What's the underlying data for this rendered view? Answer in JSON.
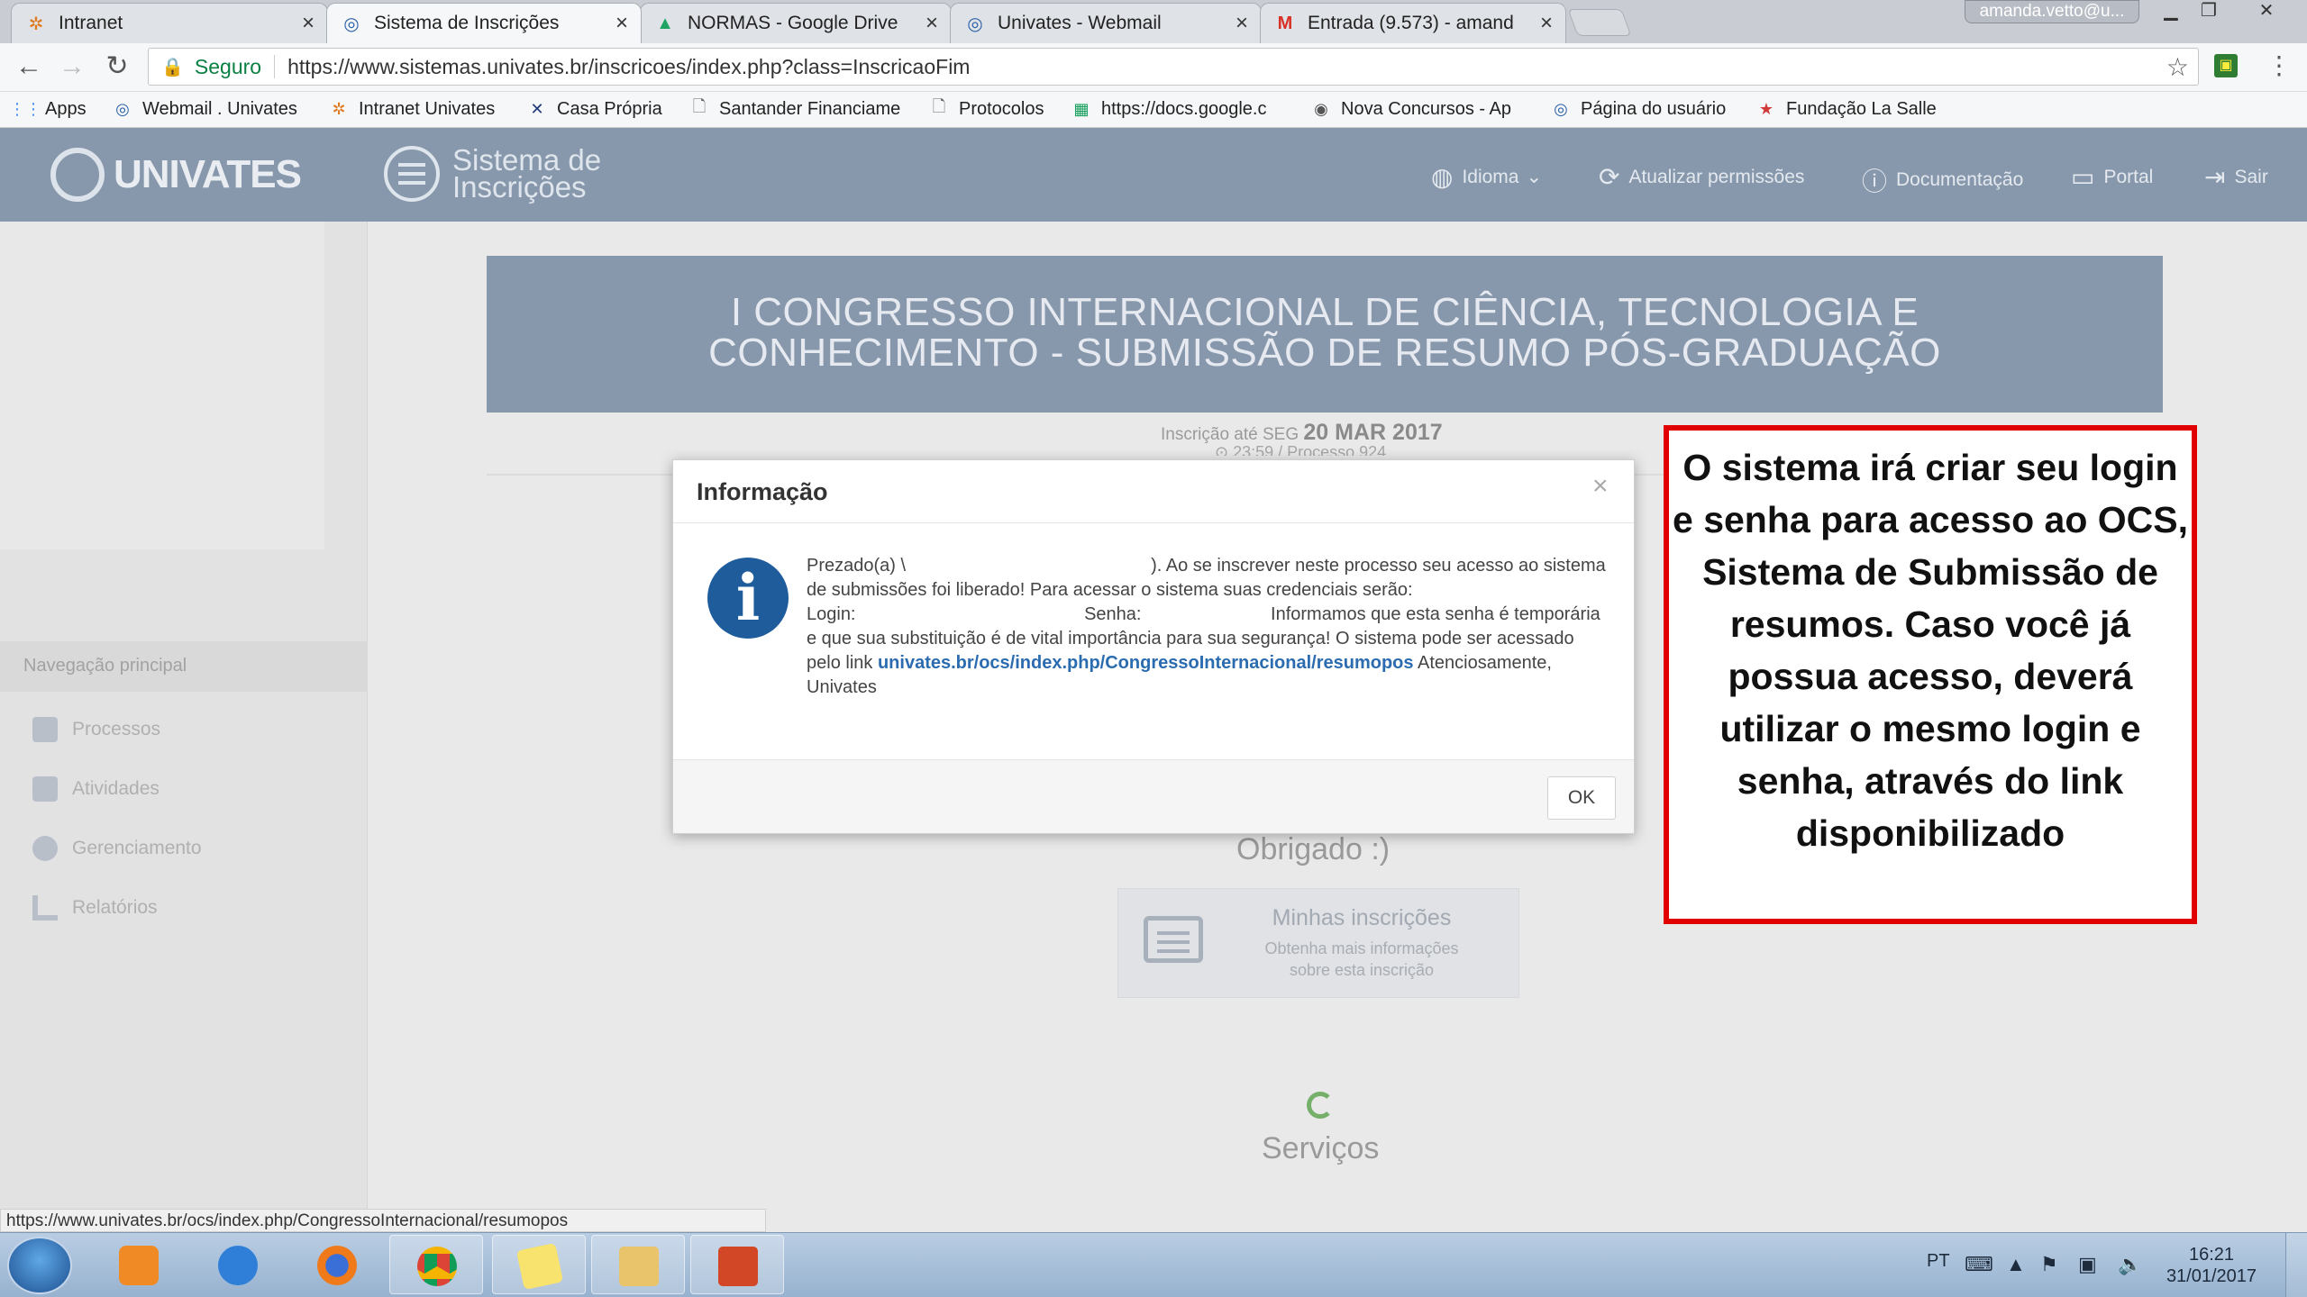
{
  "browser": {
    "tabs": [
      {
        "title": "Intranet",
        "icon": "intranet-icon",
        "active": false
      },
      {
        "title": "Sistema de Inscrições",
        "icon": "univates-icon",
        "active": true
      },
      {
        "title": "NORMAS - Google Drive",
        "icon": "google-drive-icon",
        "active": false
      },
      {
        "title": "Univates - Webmail",
        "icon": "univates-icon",
        "active": false
      },
      {
        "title": "Entrada (9.573) - amand",
        "icon": "gmail-icon",
        "active": false
      }
    ],
    "tab_close_glyph": "×",
    "user_chip": "amanda.vetto@u...",
    "address": {
      "secure_label": "Seguro",
      "url": "https://www.sistemas.univates.br/inscricoes/index.php?class=InscricaoFim"
    },
    "bookmarks": [
      {
        "label": "Apps",
        "icon": "apps-grid-icon"
      },
      {
        "label": "Webmail . Univates",
        "icon": "univates-icon"
      },
      {
        "label": "Intranet Univates",
        "icon": "intranet-icon"
      },
      {
        "label": "Casa Própria",
        "icon": "casa-propria-icon"
      },
      {
        "label": "Santander Financiame",
        "icon": "page-icon"
      },
      {
        "label": "Protocolos",
        "icon": "page-icon"
      },
      {
        "label": "https://docs.google.c",
        "icon": "sheets-icon"
      },
      {
        "label": "Nova Concursos - Ap",
        "icon": "nova-concursos-icon"
      },
      {
        "label": "Página do usuário",
        "icon": "univates-icon"
      },
      {
        "label": "Fundação La Salle",
        "icon": "la-salle-icon"
      }
    ]
  },
  "site": {
    "logo_text": "UNIVATES",
    "system_name_line1": "Sistema de",
    "system_name_line2": "Inscrições",
    "top_nav": [
      {
        "label": "Idioma",
        "icon": "globe-icon",
        "caret": "⌄"
      },
      {
        "label": "Atualizar permissões",
        "icon": "refresh-icon"
      },
      {
        "label": "Documentação",
        "icon": "help-icon"
      },
      {
        "label": "Portal",
        "icon": "portal-icon"
      },
      {
        "label": "Sair",
        "icon": "logout-icon"
      }
    ],
    "sidebar": {
      "heading": "Navegação principal",
      "items": [
        {
          "label": "Processos",
          "icon": "calendar-icon"
        },
        {
          "label": "Atividades",
          "icon": "clipboard-icon"
        },
        {
          "label": "Gerenciamento",
          "icon": "user-icon"
        },
        {
          "label": "Relatórios",
          "icon": "bar-chart-icon"
        }
      ]
    },
    "banner_line1": "I CONGRESSO INTERNACIONAL DE CIÊNCIA, TECNOLOGIA E",
    "banner_line2": "CONHECIMENTO - SUBMISSÃO DE RESUMO PÓS-GRADUAÇÃO",
    "deadline_prefix": "Inscrição até SEG",
    "deadline_date": "20 MAR 2017",
    "process_line": "⊙ 23:59 / Processo 924",
    "thanks": "Obrigado :)",
    "card_title": "Minhas inscrições",
    "card_sub_line1": "Obtenha mais informações",
    "card_sub_line2": "sobre esta inscrição",
    "services": "Serviços"
  },
  "modal": {
    "title": "Informação",
    "close_glyph": "×",
    "greeting": "Prezado(a) \\",
    "after_name": "). Ao se inscrever neste processo seu acesso ao sistema de submissões foi liberado! Para acessar o sistema suas credenciais serão:",
    "login_label": "Login:",
    "password_label": "Senha:",
    "after_password": "Informamos que esta senha é temporária e que sua substituição é de vital importância para sua segurança! O sistema pode ser acessado pelo link",
    "link": "univates.br/ocs/index.php/CongressoInternacional/resumopos",
    "closing": "Atenciosamente,",
    "signature": "Univates",
    "ok_label": "OK"
  },
  "callout_text": "O sistema irá criar seu login e senha para acesso ao OCS, Sistema de Submissão de resumos. Caso você já possua acesso, deverá utilizar o mesmo login e senha, através do link disponibilizado",
  "status_url": "https://www.univates.br/ocs/index.php/CongressoInternacional/resumopos",
  "taskbar": {
    "apps": [
      "windows-media-player-icon",
      "internet-explorer-icon",
      "firefox-icon",
      "chrome-icon",
      "sticky-notes-icon",
      "explorer-icon",
      "powerpoint-icon"
    ],
    "lang": "PT",
    "time": "16:21",
    "date": "31/01/2017"
  },
  "colors": {
    "navbar": "#8798ac",
    "banner": "#8898ac",
    "callout_border": "#e10000",
    "info_icon": "#1f5c9c",
    "link": "#2b6cb0"
  }
}
